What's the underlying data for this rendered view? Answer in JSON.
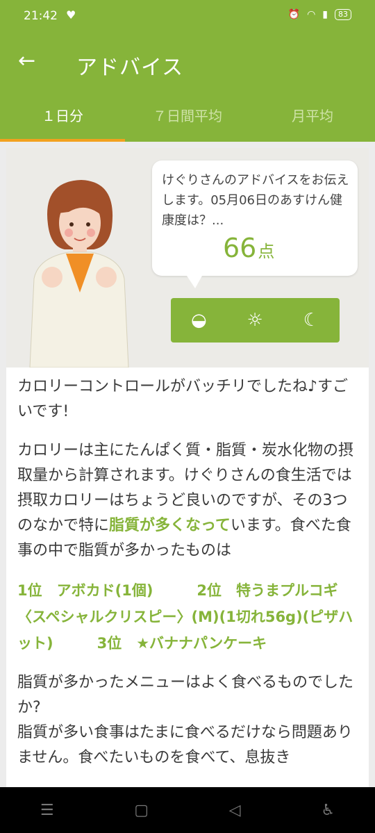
{
  "status": {
    "time": "21:42",
    "battery": "83"
  },
  "appbar": {
    "title": "アドバイス"
  },
  "tabs": [
    {
      "label": "１日分"
    },
    {
      "label": "７日間平均"
    },
    {
      "label": "月平均"
    }
  ],
  "bubble": {
    "text": "けぐりさんのアドバイスをお伝えします。05月06日のあすけん健康度は？...",
    "score": "66",
    "unit": "点"
  },
  "advice": {
    "p1": "カロリーコントロールがバッチリでしたね♪すごいです!",
    "p2_a": "カロリーは主にたんぱく質・脂質・炭水化物の摂取量から計算されます。けぐりさんの食生活では摂取カロリーはちょうど良いのですが、その3つのなかで特に",
    "p2_hl": "脂質が多くなって",
    "p2_b": "います。食べた食事の中で脂質が多かったものは",
    "ranking": "1位　アボカド(1個)　　　2位　特うまプルコギ〈スペシャルクリスピー〉(M)(1切れ56g)(ピザハット)　　　3位　★バナナパンケーキ",
    "p3": "脂質が多かったメニューはよく食べるものでしたか?",
    "p4": "脂質が多い食事はたまに食べるだけなら問題ありません。食べたいものを食べて、息抜き"
  },
  "colors": {
    "accent": "#86b43a",
    "tab_indicator": "#f2a11f"
  }
}
